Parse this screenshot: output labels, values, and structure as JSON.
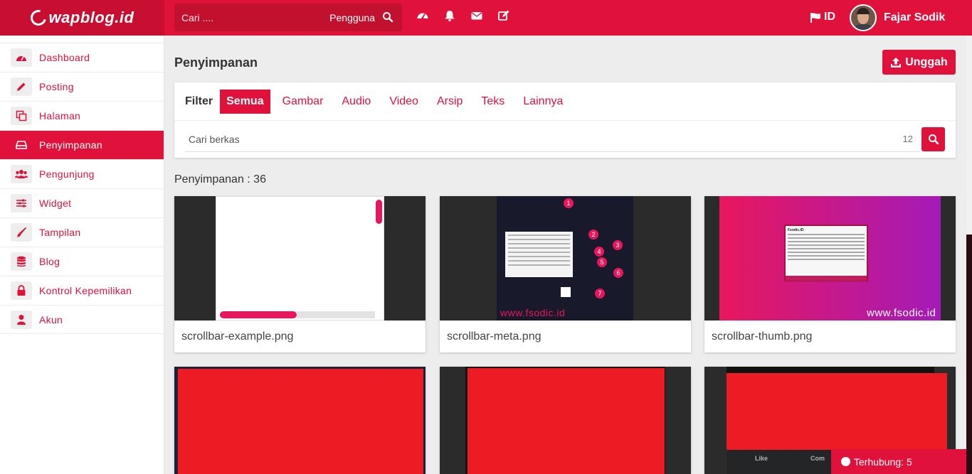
{
  "brand": {
    "logo_text": "wapblog.id"
  },
  "topbar": {
    "search_placeholder": "Cari ....",
    "search_type": "Pengguna",
    "icons": [
      "dashboard-icon",
      "bell-icon",
      "envelope-icon",
      "edit-icon"
    ],
    "language": "ID",
    "user_name": "Fajar Sodik"
  },
  "sidebar": {
    "items": [
      {
        "label": "Dashboard",
        "icon": "dashboard-icon"
      },
      {
        "label": "Posting",
        "icon": "pencil-icon"
      },
      {
        "label": "Halaman",
        "icon": "pages-icon"
      },
      {
        "label": "Penyimpanan",
        "icon": "drive-icon",
        "active": true
      },
      {
        "label": "Pengunjung",
        "icon": "users-icon"
      },
      {
        "label": "Widget",
        "icon": "sliders-icon"
      },
      {
        "label": "Tampilan",
        "icon": "brush-icon"
      },
      {
        "label": "Blog",
        "icon": "database-icon"
      },
      {
        "label": "Kontrol Kepemilikan",
        "icon": "lock-icon"
      },
      {
        "label": "Akun",
        "icon": "user-icon"
      }
    ]
  },
  "main": {
    "title": "Penyimpanan",
    "upload_label": "Unggah",
    "filter": {
      "label": "Filter",
      "tabs": [
        "Semua",
        "Gambar",
        "Audio",
        "Video",
        "Arsip",
        "Teks",
        "Lainnya"
      ],
      "active_tab": "Semua"
    },
    "file_search": {
      "placeholder": "Cari berkas",
      "count": "12"
    },
    "storage_count": "Penyimpanan : 36",
    "files": [
      {
        "name": "scrollbar-example.png"
      },
      {
        "name": "scrollbar-meta.png",
        "watermark": "www.fsodic.id",
        "markers": [
          "1",
          "2",
          "3",
          "4",
          "5",
          "6",
          "7"
        ]
      },
      {
        "name": "scrollbar-thumb.png",
        "watermark": "www.fsodic.id",
        "snippet_title": "Fsodic.ID"
      },
      {
        "name": ""
      },
      {
        "name": ""
      },
      {
        "name": "",
        "buttons": [
          "Like",
          "Com"
        ]
      }
    ]
  },
  "status": {
    "label": "Terhubung: 5"
  },
  "colors": {
    "primary": "#e0123b",
    "primary_dark": "#c80f32",
    "sidebar_bg": "#ffffff",
    "page_bg": "#ededed"
  }
}
